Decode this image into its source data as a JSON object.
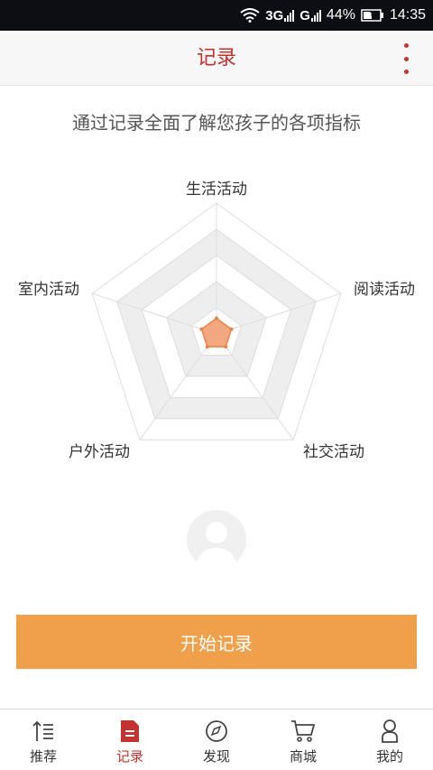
{
  "status_bar": {
    "signal1": "3G",
    "signal2": "G",
    "battery": "44%",
    "time": "14:35"
  },
  "header": {
    "title": "记录"
  },
  "subtitle": "通过记录全面了解您孩子的各项指标",
  "radar": {
    "labels": [
      "生活活动",
      "阅读活动",
      "社交活动",
      "户外活动",
      "室内活动"
    ],
    "levels": 5,
    "values": [
      0.12,
      0.12,
      0.12,
      0.12,
      0.12
    ],
    "fill_color": "#f2a77e",
    "stroke_color": "#e8824f",
    "band_color": "#eeeeee"
  },
  "start_button": {
    "label": "开始记录"
  },
  "tabs": [
    {
      "label": "推荐",
      "icon": "recommend-icon"
    },
    {
      "label": "记录",
      "icon": "record-icon"
    },
    {
      "label": "发现",
      "icon": "compass-icon"
    },
    {
      "label": "商城",
      "icon": "cart-icon"
    },
    {
      "label": "我的",
      "icon": "profile-icon"
    }
  ],
  "active_tab": "记录",
  "colors": {
    "accent": "#c2332f",
    "button": "#f0a04b"
  }
}
